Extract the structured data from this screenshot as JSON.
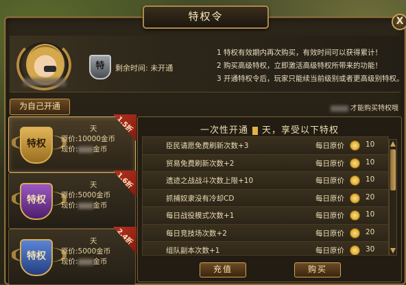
{
  "title": "特权令",
  "close_label": "X",
  "header": {
    "shield_text": "特",
    "remain_label": "剩余时间:",
    "remain_value": "未开通",
    "rules": [
      "1 特权有效期内再次购买，有效时间可以获得累计！",
      "2 购买高级特权，立即激活高级特权所带来的功能！",
      "3 开通特权令后，玩家只能续当前级别或者更高级别特权。"
    ],
    "self_open_label": "为自己开通",
    "vip_note": "才能购买特权哦"
  },
  "cards": [
    {
      "discount": "1.5折",
      "days": "天",
      "orig_label": "原价:",
      "orig_value": "10000金币",
      "now_label": "现价:",
      "now_suffix": "金币",
      "emblem": "特权",
      "color": "#c89a3a"
    },
    {
      "discount": "1.6折",
      "days": "天",
      "orig_label": "原价:",
      "orig_value": "5000金币",
      "now_label": "现价:",
      "now_suffix": "金币",
      "emblem": "特权",
      "color": "#7d3fa6"
    },
    {
      "discount": "2.4折",
      "days": "天",
      "orig_label": "原价:",
      "orig_value": "5000金币",
      "now_label": "现价:",
      "now_suffix": "金币",
      "emblem": "特权",
      "color": "#3d5fa8"
    }
  ],
  "right": {
    "title_prefix": "一次性开通",
    "title_suffix": "天，享受以下特权",
    "rows": [
      {
        "text": "臣民请愿免费刷新次数+3",
        "label": "每日原价",
        "value": "10"
      },
      {
        "text": "贸易免费刷新次数+2",
        "label": "每日原价",
        "value": "10"
      },
      {
        "text": "遗迹之战战斗次数上限+10",
        "label": "每日原价",
        "value": "10"
      },
      {
        "text": "抓捕奴隶没有冷却CD",
        "label": "每日原价",
        "value": "20"
      },
      {
        "text": "每日战役模式次数+1",
        "label": "每日原价",
        "value": "10"
      },
      {
        "text": "每日竞技场次数+2",
        "label": "每日原价",
        "value": "20"
      },
      {
        "text": "组队副本次数+1",
        "label": "每日原价",
        "value": "30"
      }
    ],
    "recharge_label": "充值",
    "buy_label": "购买"
  }
}
